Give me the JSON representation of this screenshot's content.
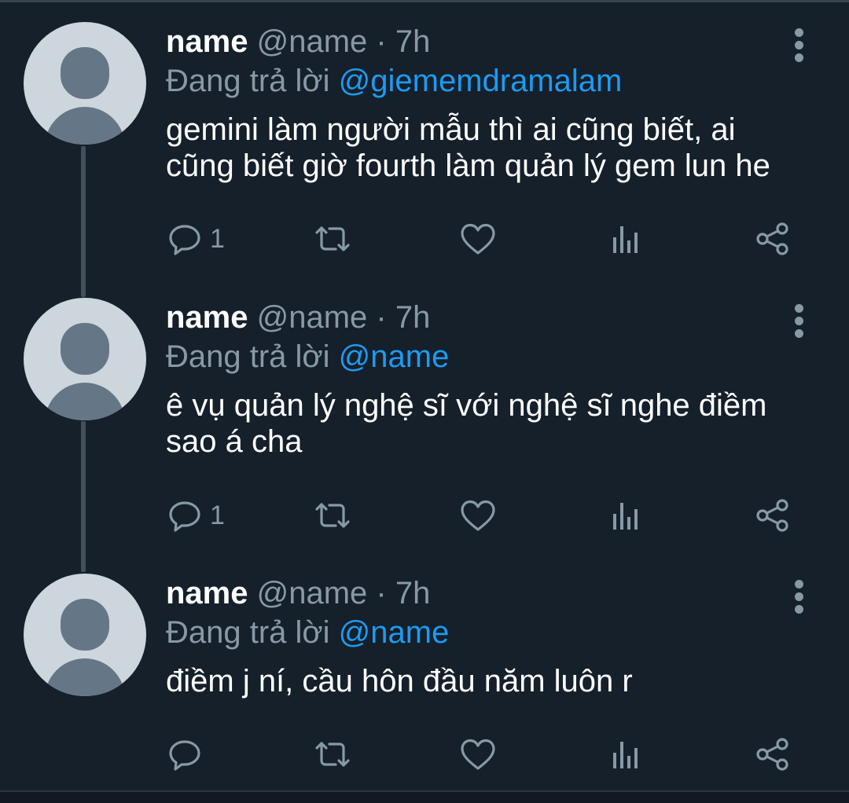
{
  "tweets": [
    {
      "name": "name",
      "handle": "@name",
      "dot": "·",
      "time": "7h",
      "reply_prefix": "Đang trả lời",
      "reply_to": "@giememdramalam",
      "text": "gemini làm người mẫu thì ai cũng biết, ai cũng biết giờ fourth làm quản lý gem lun he",
      "reply_count": "1"
    },
    {
      "name": "name",
      "handle": "@name",
      "dot": "·",
      "time": "7h",
      "reply_prefix": "Đang trả lời",
      "reply_to": "@name",
      "text": "ê vụ quản lý nghệ sĩ với nghệ sĩ nghe điềm sao á cha",
      "reply_count": "1"
    },
    {
      "name": "name",
      "handle": "@name",
      "dot": "·",
      "time": "7h",
      "reply_prefix": "Đang trả lời",
      "reply_to": "@name",
      "text": "điềm j ní, cầu hôn đầu năm luôn r",
      "reply_count": ""
    }
  ],
  "icons": {
    "reply": "reply-icon",
    "retweet": "retweet-icon",
    "like": "heart-icon",
    "analytics": "analytics-icon",
    "share": "share-icon",
    "more": "more-vertical-icon"
  },
  "colors": {
    "background": "#15202b",
    "secondary_text": "#8899a6",
    "accent": "#1d9bf0",
    "thread_line": "#42505c"
  }
}
